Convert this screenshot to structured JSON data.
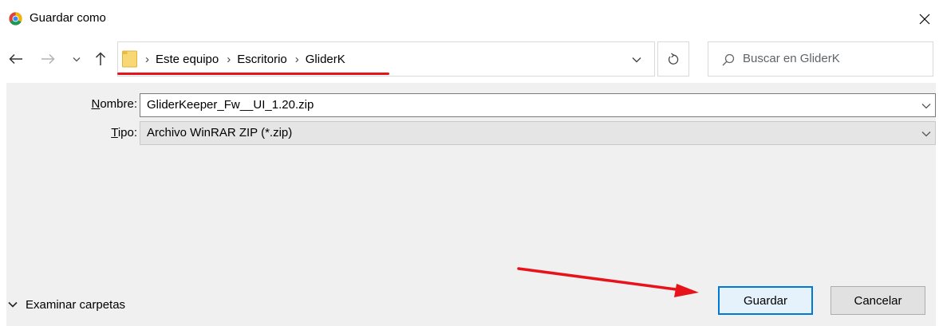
{
  "window": {
    "title": "Guardar como",
    "icon": "chrome-icon",
    "close_icon": "close-icon"
  },
  "nav": {
    "back_icon": "arrow-left-icon",
    "forward_icon": "arrow-right-icon",
    "recent_icon": "chevron-down-icon",
    "up_icon": "arrow-up-icon",
    "refresh_icon": "refresh-icon"
  },
  "address": {
    "breadcrumbs": [
      "Este equipo",
      "Escritorio",
      "GliderK"
    ],
    "separator": "›"
  },
  "search": {
    "placeholder": "Buscar en GliderK"
  },
  "form": {
    "nombre_label_underlined": "N",
    "nombre_label_rest": "ombre:",
    "nombre_value": "GliderKeeper_Fw__UI_1.20.zip",
    "tipo_label_underlined": "T",
    "tipo_label_rest": "ipo:",
    "tipo_value": "Archivo WinRAR ZIP (*.zip)"
  },
  "footer": {
    "browse_label": "Examinar carpetas",
    "save_label": "Guardar",
    "cancel_label": "Cancelar"
  },
  "colors": {
    "annotation_red": "#e8131a",
    "focus_blue": "#0078d7",
    "content_bg": "#f0f0f0"
  }
}
